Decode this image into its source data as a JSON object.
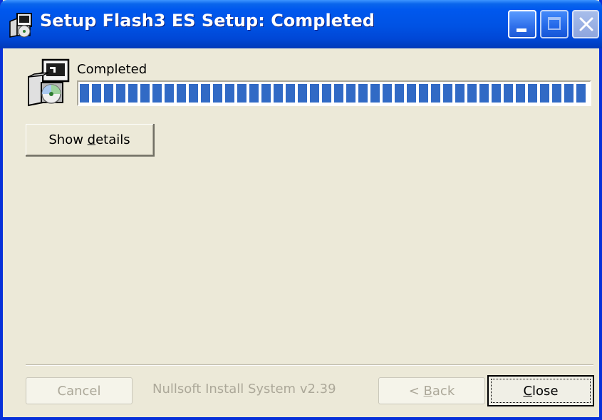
{
  "window": {
    "title": "Setup Flash3 ES Setup: Completed",
    "controls": {
      "minimize": "minimize-icon",
      "maximize": "maximize-icon",
      "close": "close-icon"
    }
  },
  "status": {
    "label": "Completed",
    "progress_percent": 100
  },
  "buttons": {
    "show_details_pre": "Show ",
    "show_details_accel": "d",
    "show_details_post": "etails",
    "cancel": "Cancel",
    "back_pre": "< ",
    "back_accel": "B",
    "back_post": "ack",
    "close_accel": "C",
    "close_post": "lose"
  },
  "footer": {
    "branding": "Nullsoft Install System v2.39"
  },
  "colors": {
    "titlebar": "#0052E3",
    "frame": "#0831D9",
    "progress": "#316AC5",
    "background": "#ECE9D8",
    "disabled_text": "#ACA899"
  }
}
